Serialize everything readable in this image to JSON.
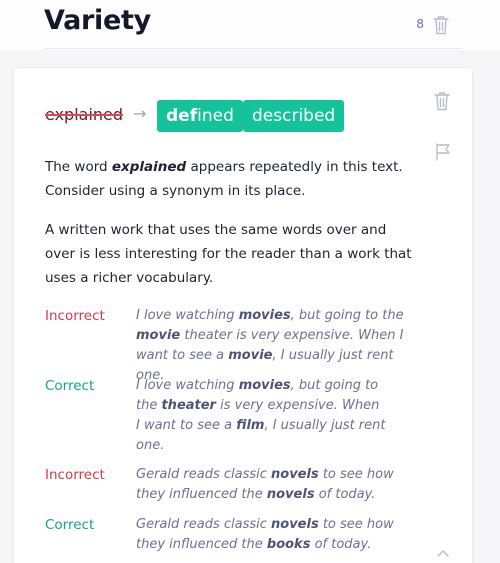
{
  "header": {
    "title": "Variety",
    "count": "8",
    "trash_icon": "trash-icon"
  },
  "card": {
    "original_word": "explained",
    "arrow": "→",
    "suggestions": [
      {
        "prefix": "def",
        "suffix": "ined"
      },
      {
        "prefix": "",
        "suffix": "described"
      }
    ],
    "para1": {
      "before": "The word ",
      "word": "explained",
      "after": " appears repeatedly in this text. Consider using a synonym in its place."
    },
    "para2": "A written work that uses the same words over and over is less interesting for the reader than a work that uses a richer vocabulary.",
    "examples": [
      {
        "label": "Incorrect",
        "type": "incorrect",
        "parts": [
          {
            "t": "I love watching "
          },
          {
            "t": "movies",
            "kw": true
          },
          {
            "t": ", but going to the "
          },
          {
            "t": "movie",
            "kw": true
          },
          {
            "t": " theater is very expensive. When I want to see a "
          },
          {
            "t": "movie",
            "kw": true
          },
          {
            "t": ", I usually just rent one."
          }
        ]
      },
      {
        "label": "Correct",
        "type": "correct",
        "parts": [
          {
            "t": "I love watching "
          },
          {
            "t": "movies",
            "kw": true
          },
          {
            "t": ", but going to the "
          },
          {
            "t": "theater",
            "kw": true
          },
          {
            "t": " is very expensive. When I want to see a "
          },
          {
            "t": "film",
            "kw": true
          },
          {
            "t": ", I usually just rent one."
          }
        ]
      },
      {
        "label": "Incorrect",
        "type": "incorrect",
        "parts": [
          {
            "t": "Gerald reads classic "
          },
          {
            "t": "novels",
            "kw": true
          },
          {
            "t": " to see how they influenced the "
          },
          {
            "t": "novels",
            "kw": true
          },
          {
            "t": " of today."
          }
        ]
      },
      {
        "label": "Correct",
        "type": "correct",
        "parts": [
          {
            "t": "Gerald reads classic "
          },
          {
            "t": "novels",
            "kw": true
          },
          {
            "t": " to see how they influenced the "
          },
          {
            "t": "books",
            "kw": true
          },
          {
            "t": " of today."
          }
        ]
      }
    ],
    "icons": {
      "trash": "trash-icon",
      "flag": "flag-icon",
      "collapse": "chevron-up-icon"
    }
  },
  "colors": {
    "accent": "#15c39a",
    "incorrect": "#d9374b",
    "correct": "#14a67f",
    "strike": "#e0455c"
  }
}
